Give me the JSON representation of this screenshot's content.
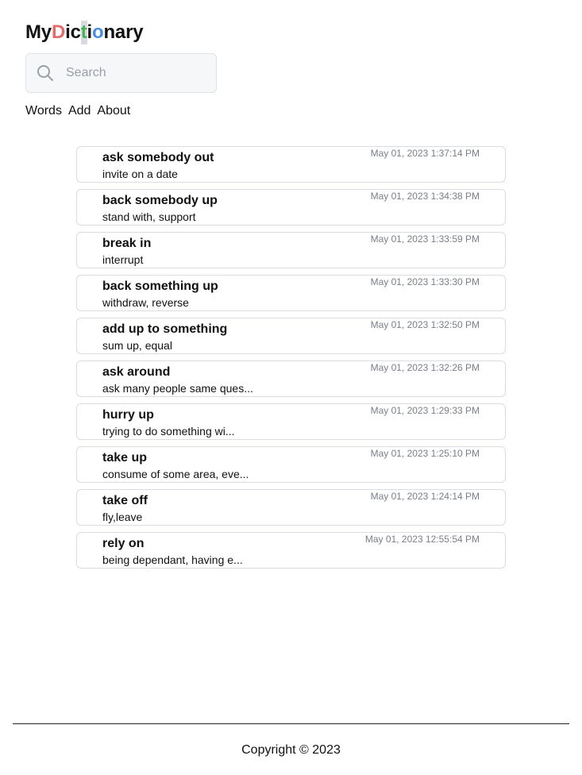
{
  "logo": {
    "letters": [
      {
        "ch": "M",
        "color": "#111111"
      },
      {
        "ch": "y",
        "color": "#111111"
      },
      {
        "ch": "D",
        "color": "#e46a6a"
      },
      {
        "ch": "i",
        "color": "#111111"
      },
      {
        "ch": "c",
        "color": "#111111"
      },
      {
        "ch": "t",
        "color": "#48b05a"
      },
      {
        "ch": "i",
        "color": "#111111"
      },
      {
        "ch": "o",
        "color": "#4a90e2"
      },
      {
        "ch": "n",
        "color": "#111111"
      },
      {
        "ch": "a",
        "color": "#111111"
      },
      {
        "ch": "r",
        "color": "#111111"
      },
      {
        "ch": "y",
        "color": "#111111"
      }
    ]
  },
  "search": {
    "placeholder": "Search",
    "value": "",
    "icon": "search-icon"
  },
  "nav": {
    "words": "Words",
    "add": "Add",
    "about": "About"
  },
  "entries": [
    {
      "word": "ask somebody out",
      "definition": "invite on a date",
      "date": "May 01, 2023 1:37:14 PM"
    },
    {
      "word": "back somebody up",
      "definition": "stand with, support",
      "date": "May 01, 2023 1:34:38 PM"
    },
    {
      "word": "break in",
      "definition": "interrupt",
      "date": "May 01, 2023 1:33:59 PM"
    },
    {
      "word": "back something up",
      "definition": "withdraw, reverse",
      "date": "May 01, 2023 1:33:30 PM"
    },
    {
      "word": "add up to something",
      "definition": "sum up, equal",
      "date": "May 01, 2023 1:32:50 PM"
    },
    {
      "word": "ask around",
      "definition": "ask many people same ques...",
      "date": "May 01, 2023 1:32:26 PM"
    },
    {
      "word": "hurry up",
      "definition": "trying to do something wi...",
      "date": "May 01, 2023 1:29:33 PM"
    },
    {
      "word": "take up",
      "definition": "consume of some area, eve...",
      "date": "May 01, 2023 1:25:10 PM"
    },
    {
      "word": "take off",
      "definition": "fly,leave",
      "date": "May 01, 2023 1:24:14 PM"
    },
    {
      "word": "rely on",
      "definition": "being dependant, having e...",
      "date": "May 01, 2023 12:55:54 PM"
    }
  ],
  "footer": {
    "copyright": "Copyright © 2023"
  }
}
